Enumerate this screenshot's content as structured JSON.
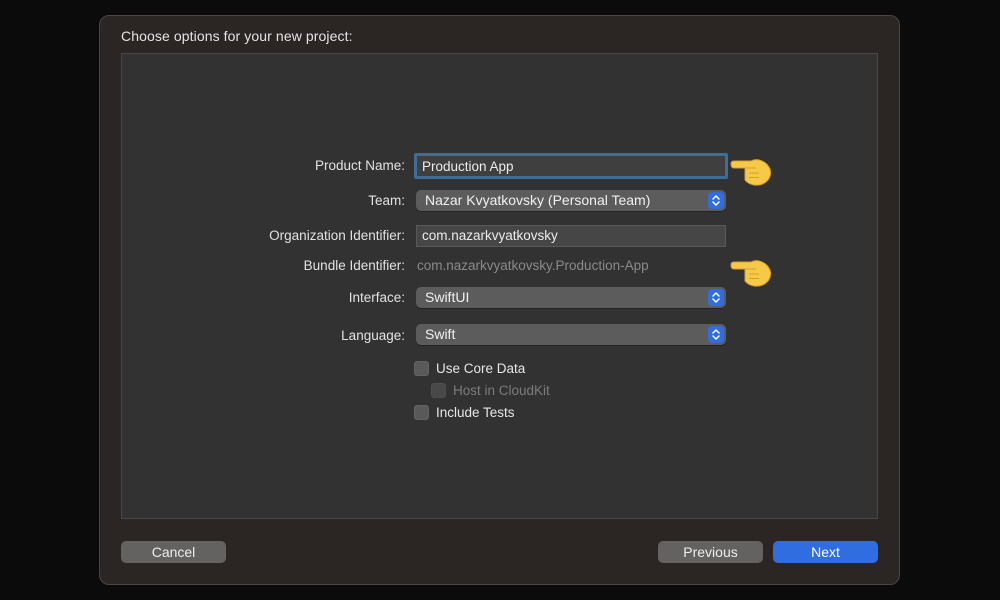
{
  "dialog": {
    "title": "Choose options for your new project:"
  },
  "form": {
    "product_name": {
      "label": "Product Name:",
      "value": "Production App"
    },
    "team": {
      "label": "Team:",
      "value": "Nazar Kvyatkovsky (Personal Team)"
    },
    "organization_identifier": {
      "label": "Organization Identifier:",
      "value": "com.nazarkvyatkovsky"
    },
    "bundle_identifier": {
      "label": "Bundle Identifier:",
      "value": "com.nazarkvyatkovsky.Production-App"
    },
    "interface": {
      "label": "Interface:",
      "value": "SwiftUI"
    },
    "language": {
      "label": "Language:",
      "value": "Swift"
    },
    "checkboxes": {
      "use_core_data": {
        "label": "Use Core Data",
        "checked": false
      },
      "host_in_cloudkit": {
        "label": "Host in CloudKit",
        "checked": false,
        "enabled": false
      },
      "include_tests": {
        "label": "Include Tests",
        "checked": false
      }
    }
  },
  "buttons": {
    "cancel": "Cancel",
    "previous": "Previous",
    "next": "Next"
  },
  "annotations": {
    "pointer_icon": "pointing-hand-emoji",
    "pointer_color": "#f7c948"
  },
  "colors": {
    "accent": "#2f6de0",
    "focus_ring": "#3c6e98",
    "sheet_background": "#2b2523",
    "panel_background": "#333232"
  }
}
